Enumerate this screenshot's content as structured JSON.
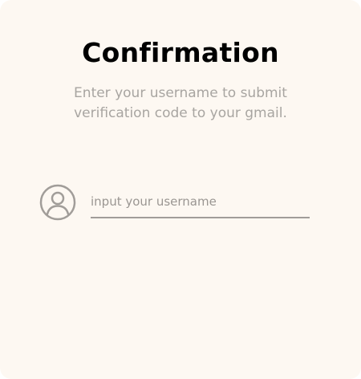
{
  "dialog": {
    "title": "Confirmation",
    "subtitle": "Enter your username to submit verification code to your gmail."
  },
  "username": {
    "icon": "user-circle-icon",
    "placeholder": "input your username",
    "value": ""
  }
}
